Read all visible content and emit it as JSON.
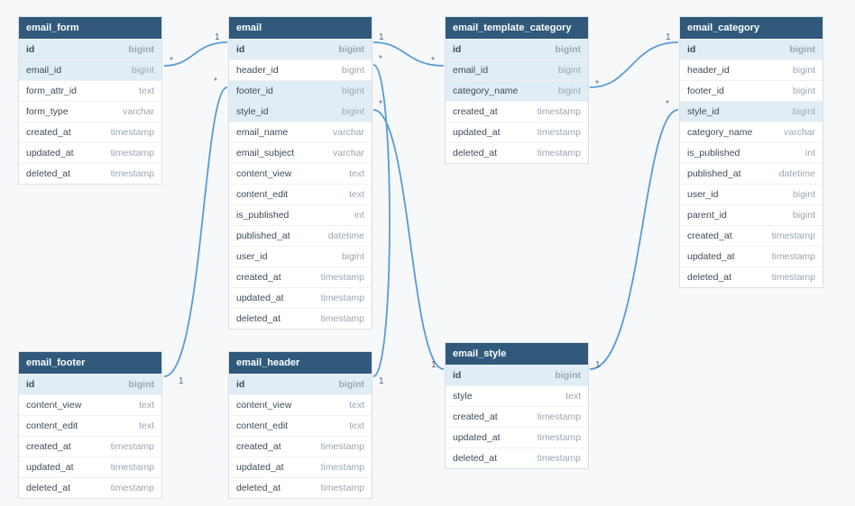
{
  "tables": {
    "email_form": {
      "title": "email_form",
      "rows": [
        {
          "name": "id",
          "type": "bigint",
          "pk": true
        },
        {
          "name": "email_id",
          "type": "bigint",
          "hl": true
        },
        {
          "name": "form_attr_id",
          "type": "text"
        },
        {
          "name": "form_type",
          "type": "varchar"
        },
        {
          "name": "created_at",
          "type": "timestamp"
        },
        {
          "name": "updated_at",
          "type": "timestamp"
        },
        {
          "name": "deleted_at",
          "type": "timestamp"
        }
      ]
    },
    "email": {
      "title": "email",
      "rows": [
        {
          "name": "id",
          "type": "bigint",
          "pk": true
        },
        {
          "name": "header_id",
          "type": "bigint"
        },
        {
          "name": "footer_id",
          "type": "bigint",
          "hl": true
        },
        {
          "name": "style_id",
          "type": "bigint",
          "hl": true
        },
        {
          "name": "email_name",
          "type": "varchar"
        },
        {
          "name": "email_subject",
          "type": "varchar"
        },
        {
          "name": "content_view",
          "type": "text"
        },
        {
          "name": "content_edit",
          "type": "text"
        },
        {
          "name": "is_published",
          "type": "int"
        },
        {
          "name": "published_at",
          "type": "datetime"
        },
        {
          "name": "user_id",
          "type": "bigint"
        },
        {
          "name": "created_at",
          "type": "timestamp"
        },
        {
          "name": "updated_at",
          "type": "timestamp"
        },
        {
          "name": "deleted_at",
          "type": "timestamp"
        }
      ]
    },
    "email_template_category": {
      "title": "email_template_category",
      "rows": [
        {
          "name": "id",
          "type": "bigint",
          "pk": true
        },
        {
          "name": "email_id",
          "type": "bigint",
          "hl": true
        },
        {
          "name": "category_name",
          "type": "bigint",
          "hl": true
        },
        {
          "name": "created_at",
          "type": "timestamp"
        },
        {
          "name": "updated_at",
          "type": "timestamp"
        },
        {
          "name": "deleted_at",
          "type": "timestamp"
        }
      ]
    },
    "email_category": {
      "title": "email_category",
      "rows": [
        {
          "name": "id",
          "type": "bigint",
          "pk": true
        },
        {
          "name": "header_id",
          "type": "bigint"
        },
        {
          "name": "footer_id",
          "type": "bigint"
        },
        {
          "name": "style_id",
          "type": "bigint",
          "hl": true
        },
        {
          "name": "category_name",
          "type": "varchar"
        },
        {
          "name": "is_published",
          "type": "int"
        },
        {
          "name": "published_at",
          "type": "datetime"
        },
        {
          "name": "user_id",
          "type": "bigint"
        },
        {
          "name": "parent_id",
          "type": "bigint"
        },
        {
          "name": "created_at",
          "type": "timestamp"
        },
        {
          "name": "updated_at",
          "type": "timestamp"
        },
        {
          "name": "deleted_at",
          "type": "timestamp"
        }
      ]
    },
    "email_footer": {
      "title": "email_footer",
      "rows": [
        {
          "name": "id",
          "type": "bigint",
          "pk": true
        },
        {
          "name": "content_view",
          "type": "text"
        },
        {
          "name": "content_edit",
          "type": "text"
        },
        {
          "name": "created_at",
          "type": "timestamp"
        },
        {
          "name": "updated_at",
          "type": "timestamp"
        },
        {
          "name": "deleted_at",
          "type": "timestamp"
        }
      ]
    },
    "email_header": {
      "title": "email_header",
      "rows": [
        {
          "name": "id",
          "type": "bigint",
          "pk": true
        },
        {
          "name": "content_view",
          "type": "text"
        },
        {
          "name": "content_edit",
          "type": "text"
        },
        {
          "name": "created_at",
          "type": "timestamp"
        },
        {
          "name": "updated_at",
          "type": "timestamp"
        },
        {
          "name": "deleted_at",
          "type": "timestamp"
        }
      ]
    },
    "email_style": {
      "title": "email_style",
      "rows": [
        {
          "name": "id",
          "type": "bigint",
          "pk": true
        },
        {
          "name": "style",
          "type": "text"
        },
        {
          "name": "created_at",
          "type": "timestamp"
        },
        {
          "name": "updated_at",
          "type": "timestamp"
        },
        {
          "name": "deleted_at",
          "type": "timestamp"
        }
      ]
    }
  },
  "cardinality": {
    "one": "1",
    "many": "*"
  },
  "colors": {
    "header": "#30597b",
    "line": "#5a9bd5"
  }
}
